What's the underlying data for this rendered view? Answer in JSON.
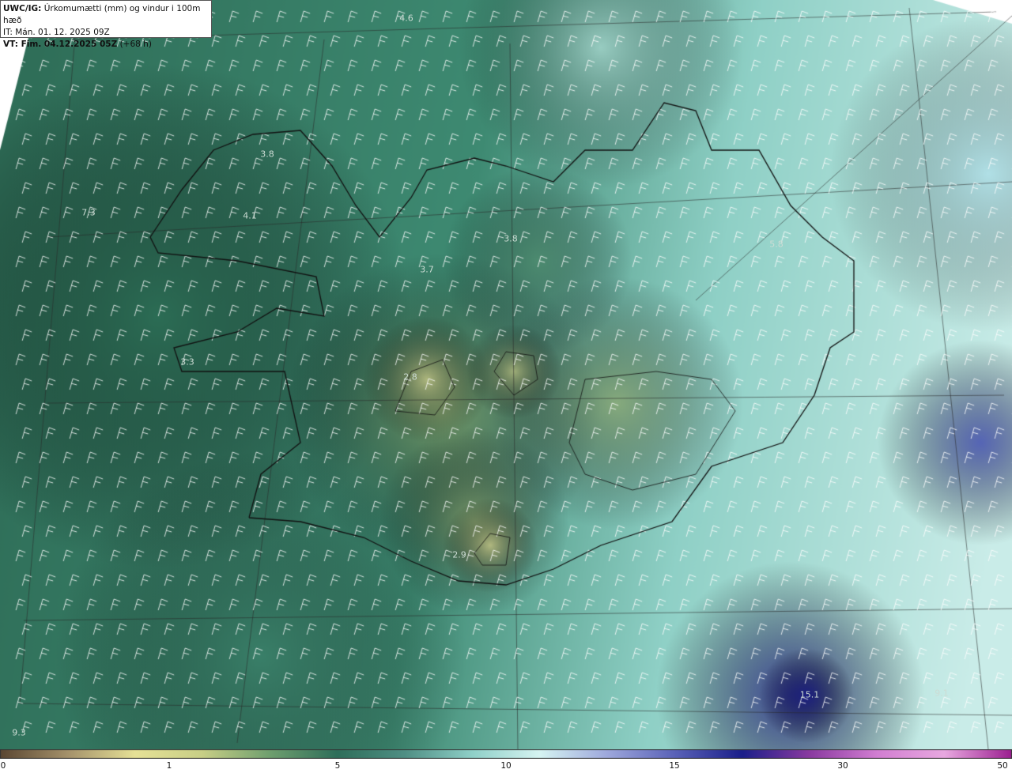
{
  "header": {
    "model": "UWC/IG:",
    "title": "Úrkomumætti (mm) og vindur i 100m hæð",
    "init_time": "IT: Mán. 01. 12. 2025 09Z",
    "valid_prefix": "VT: Fim. 04.12.2025 05Z",
    "valid_suffix": " (+68 h)"
  },
  "map_labels": [
    {
      "text": "4.6"
    },
    {
      "text": "3.8"
    },
    {
      "text": "4.1"
    },
    {
      "text": "7.3"
    },
    {
      "text": "3.7"
    },
    {
      "text": "3.8"
    },
    {
      "text": "5.8"
    },
    {
      "text": "3.3"
    },
    {
      "text": "2.8"
    },
    {
      "text": "2.9"
    },
    {
      "text": "15.1"
    },
    {
      "text": "9.1"
    },
    {
      "text": "9.3"
    }
  ],
  "colorbar": {
    "ticks": [
      "0",
      "1",
      "5",
      "10",
      "15",
      "30",
      "50"
    ],
    "colors": [
      "#5a4632",
      "#a4916a",
      "#e6e196",
      "#c8cf86",
      "#6f9f6e",
      "#2e6e5a",
      "#4f8f84",
      "#8fd0c8",
      "#d6f4f2",
      "#9ea8dc",
      "#5a62b8",
      "#1b1f8a",
      "#8a3aa0",
      "#d27ed2",
      "#e8a8e0",
      "#9b1e90"
    ]
  }
}
